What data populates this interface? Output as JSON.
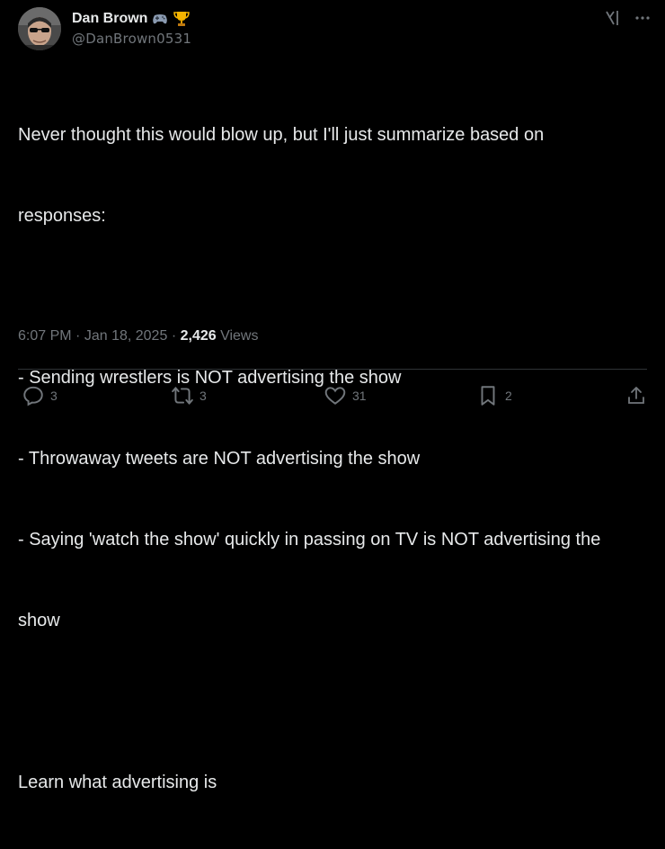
{
  "author": {
    "display_name": "Dan Brown",
    "badges": [
      "gamepad-emoji",
      "trophy-emoji"
    ],
    "handle": "@DanBrown0531"
  },
  "tweet": {
    "lines": [
      "Never thought this would blow up, but I'll just summarize based on",
      "responses:",
      "",
      "- Sending wrestlers is NOT advertising the show",
      "- Throwaway tweets are NOT advertising the show",
      "- Saying 'watch the show' quickly in passing on TV is NOT advertising the",
      "show",
      "",
      "Learn what advertising is"
    ],
    "time": "6:07 PM",
    "separator": "·",
    "date": "Jan 18, 2025",
    "views_count": "2,426",
    "views_label": "Views"
  },
  "actions": {
    "replies": "3",
    "reposts": "3",
    "likes": "31",
    "bookmarks": "2"
  },
  "colors": {
    "background": "#000000",
    "text": "#e7e9ea",
    "muted": "#71767b",
    "divider": "#2f3336"
  }
}
